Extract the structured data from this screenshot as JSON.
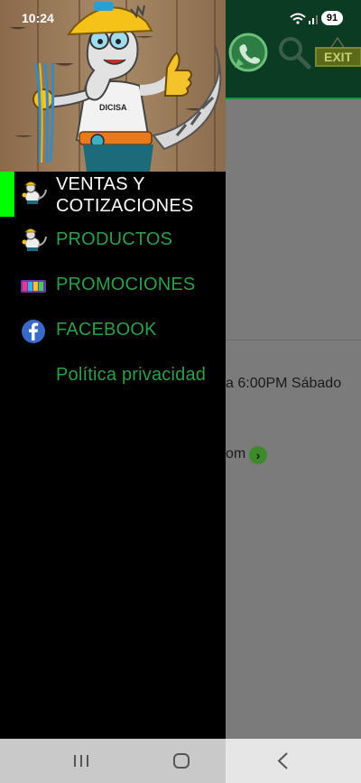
{
  "status_bar": {
    "time": "10:24",
    "battery": "91"
  },
  "background": {
    "exit_label": "EXIT",
    "hours_text": "a 6:00PM  Sábado",
    "email_text": "om"
  },
  "drawer": {
    "items": [
      {
        "label_line1": "VENTAS Y",
        "label_line2": "COTIZACIONES",
        "color": "#ffffff",
        "icon": "mascot-icon",
        "active": true
      },
      {
        "label": "PRODUCTOS",
        "color": "#2f9e4a",
        "icon": "mascot-icon"
      },
      {
        "label": "PROMOCIONES",
        "color": "#2f9e4a",
        "icon": "promo-icon"
      },
      {
        "label": "FACEBOOK",
        "color": "#2f9e4a",
        "icon": "facebook-icon"
      },
      {
        "label": "Política privacidad",
        "color": "#2f9e4a",
        "icon": ""
      }
    ],
    "accent": "#00ff00"
  },
  "nav": {
    "recents": "recents-icon",
    "home": "home-icon",
    "back": "back-icon"
  }
}
